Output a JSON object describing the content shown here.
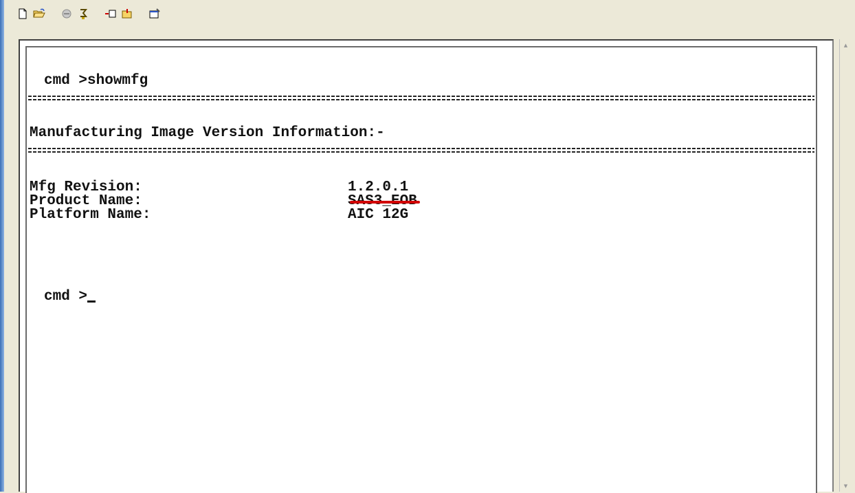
{
  "toolbar": {
    "icons": [
      "new-icon",
      "open-icon",
      "disconnect-icon",
      "connect-icon",
      "send-icon",
      "receive-icon",
      "properties-icon"
    ]
  },
  "terminal": {
    "prompt_command": "cmd >showmfg",
    "heading": "Manufacturing Image Version Information:-",
    "rows": [
      {
        "label": "Mfg Revision:",
        "value": "1.2.0.1"
      },
      {
        "label": "Product Name:",
        "value": "SAS3_EOB"
      },
      {
        "label": "Platform Name:",
        "value": "AIC 12G"
      }
    ],
    "prompt_current": "cmd >"
  },
  "colors": {
    "highlight": "#d10000",
    "background": "#ffffff",
    "text": "#111111"
  }
}
